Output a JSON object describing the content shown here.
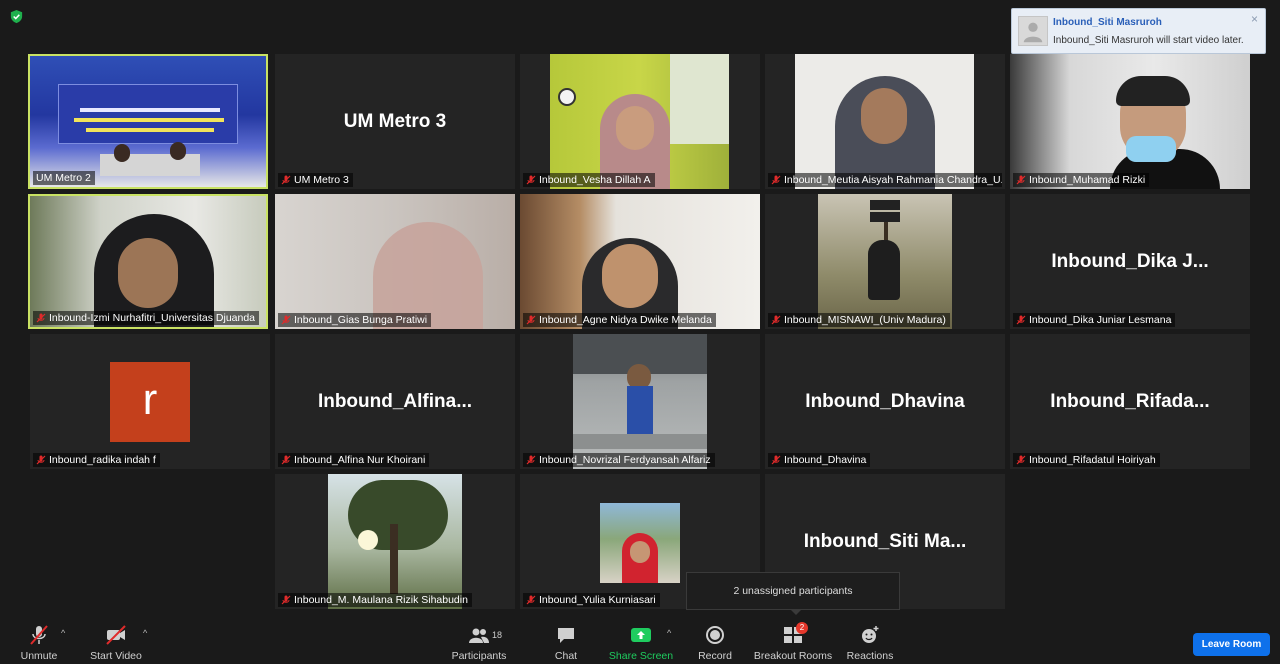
{
  "app": {
    "toast": {
      "title": "Inbound_Siti Masruroh",
      "message": "Inbound_Siti Masruroh will start video later.",
      "close": "×"
    },
    "tooltip": "2 unassigned participants"
  },
  "tiles": [
    {
      "label": "UM Metro 2",
      "big": "",
      "icon_video": "presentation-video"
    },
    {
      "label": "UM Metro 3",
      "big": "UM Metro 3"
    },
    {
      "label": "Inbound_Vesha Dillah A",
      "big": "",
      "icon_video": "webcam-video"
    },
    {
      "label": "Inbound_Meutia Aisyah Rahmania Chandra_U...",
      "big": "",
      "icon_video": "webcam-video"
    },
    {
      "label": "Inbound_Muhamad Rizki",
      "big": "",
      "icon_video": "webcam-video"
    },
    {
      "label": "Inbound-Izmi Nurhafitri_Universitas Djuanda",
      "big": "",
      "icon_video": "webcam-video"
    },
    {
      "label": "Inbound_Gias Bunga Pratiwi",
      "big": "",
      "icon_video": "webcam-video"
    },
    {
      "label": "Inbound_Agne Nidya Dwike Melanda",
      "big": "",
      "icon_video": "webcam-video"
    },
    {
      "label": "Inbound_MISNAWI_(Univ Madura)",
      "big": "",
      "icon_video": "profile-photo"
    },
    {
      "label": "Inbound_Dika Juniar Lesmana",
      "big": "Inbound_Dika  J..."
    },
    {
      "label": "Inbound_radika indah f",
      "big": "",
      "avatar": "r"
    },
    {
      "label": "Inbound_Alfina Nur Khoirani",
      "big": "Inbound_Alfina..."
    },
    {
      "label": "Inbound_Novrizal Ferdyansah Alfariz",
      "big": "",
      "icon_video": "profile-photo"
    },
    {
      "label": "Inbound_Dhavina",
      "big": "Inbound_Dhavina"
    },
    {
      "label": "Inbound_Rifadatul Hoiriyah",
      "big": "Inbound_Rifada..."
    },
    {
      "label": "Inbound_M. Maulana Rizik Sihabudin",
      "big": "",
      "icon_video": "profile-photo"
    },
    {
      "label": "Inbound_Yulia Kurniasari",
      "big": "",
      "icon_video": "profile-photo"
    },
    {
      "label": "",
      "big": "Inbound_Siti  Ma..."
    }
  ],
  "toolbar": {
    "unmute": "Unmute",
    "start_video": "Start Video",
    "participants": "Participants",
    "participants_count": "18",
    "chat": "Chat",
    "share_screen": "Share Screen",
    "record": "Record",
    "breakout_rooms": "Breakout Rooms",
    "breakout_badge": "2",
    "reactions": "Reactions",
    "leave_room": "Leave Room"
  },
  "colors": {
    "active_speaker_border": "#c9e263",
    "share_green": "#1fcc5f",
    "leave_blue": "#0e71eb",
    "badge_red": "#e5372b"
  }
}
